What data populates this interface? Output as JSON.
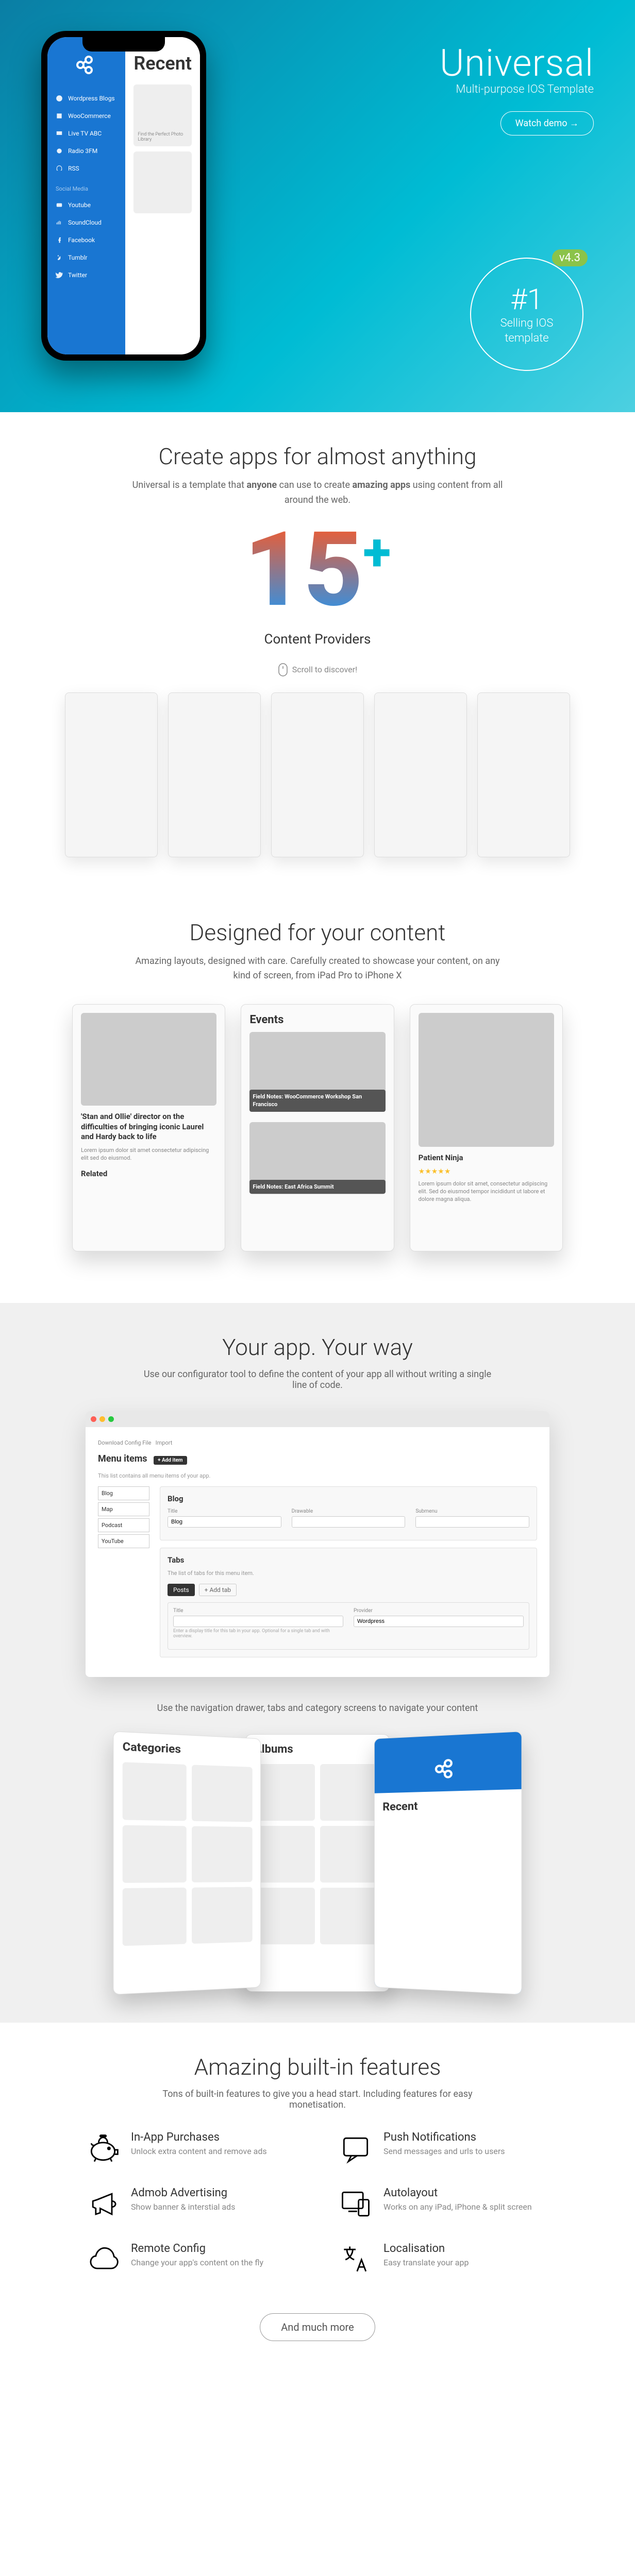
{
  "hero": {
    "title": "Universal",
    "subtitle": "Multi-purpose IOS Template",
    "watch_button": "Watch demo →",
    "version_badge": "v4.3",
    "badge_number": "#1",
    "badge_line1": "Selling IOS",
    "badge_line2": "template",
    "phone_content_title": "Recent",
    "phone_card_text": "Find the Perfect Photo Library",
    "drawer_items_media": [
      "Wordpress Blogs",
      "WooCommerce",
      "Live TV ABC",
      "Radio 3FM",
      "RSS"
    ],
    "drawer_section_social": "Social Media",
    "drawer_items_social": [
      "Youtube",
      "SoundCloud",
      "Facebook",
      "Tumblr",
      "Twitter"
    ]
  },
  "create_section": {
    "title": "Create apps for almost anything",
    "desc_pre": "Universal is a template that ",
    "desc_bold1": "anyone",
    "desc_mid": " can use to create ",
    "desc_bold2": "amazing apps",
    "desc_post": " using content from all around the web.",
    "big_number": "15",
    "big_plus": "+",
    "providers_label": "Content Providers",
    "scroll_hint": "Scroll to discover!"
  },
  "designed_section": {
    "title": "Designed for your content",
    "desc": "Amazing layouts, designed with care. Carefully created to showcase your content, on any kind of screen, from iPad Pro to iPhone X",
    "mock1_title": "'Stan and Ollie' director on the difficulties of bringing iconic Laurel and Hardy back to life",
    "mock1_related": "Related",
    "mock2_title": "Events",
    "mock2_item1": "Field Notes: WooCommerce Workshop San Francisco",
    "mock2_item2": "Field Notes: East Africa Summit",
    "mock3_title": "Patient Ninja"
  },
  "yourapp_section": {
    "title": "Your app. Your way",
    "desc": "Use our configurator tool to define the content of your app all without writing a single line of code.",
    "config_heading": "Menu items",
    "add_button": "+ Add item",
    "config_note": "This list contains all menu items of your app.",
    "panel_blog": "Blog",
    "panel_tabs": "Tabs",
    "tabs_note": "The list of tabs for this menu item.",
    "tab_field_note": "Enter a display title for this tab in your app. Optional for a single tab and with overview.",
    "label_title": "Title",
    "label_icon": "Drawable",
    "label_submenu": "Submenu",
    "label_provider": "Provider",
    "value_blog": "Blog",
    "value_wordpress": "Wordpress",
    "left_items": [
      "Blog",
      "Map",
      "Podcast",
      "YouTube"
    ],
    "nav_desc": "Use the navigation drawer, tabs and category screens to navigate your content",
    "nav_mock1_title": "Categories",
    "nav_mock2_title": "Albums",
    "nav_mock3_title": "Recent"
  },
  "features_section": {
    "title": "Amazing built-in features",
    "desc": "Tons of built-in features to give you a head start. Including features for easy monetisation.",
    "items": [
      {
        "title": "In-App Purchases",
        "desc": "Unlock extra content and remove ads"
      },
      {
        "title": "Push Notifications",
        "desc": "Send messages and urls to users"
      },
      {
        "title": "Admob Advertising",
        "desc": "Show banner & interstial ads"
      },
      {
        "title": "Autolayout",
        "desc": "Works on any iPad, iPhone & split screen"
      },
      {
        "title": "Remote Config",
        "desc": "Change your app's content on the fly"
      },
      {
        "title": "Localisation",
        "desc": "Easy translate your app"
      }
    ],
    "more_button": "And much more"
  }
}
